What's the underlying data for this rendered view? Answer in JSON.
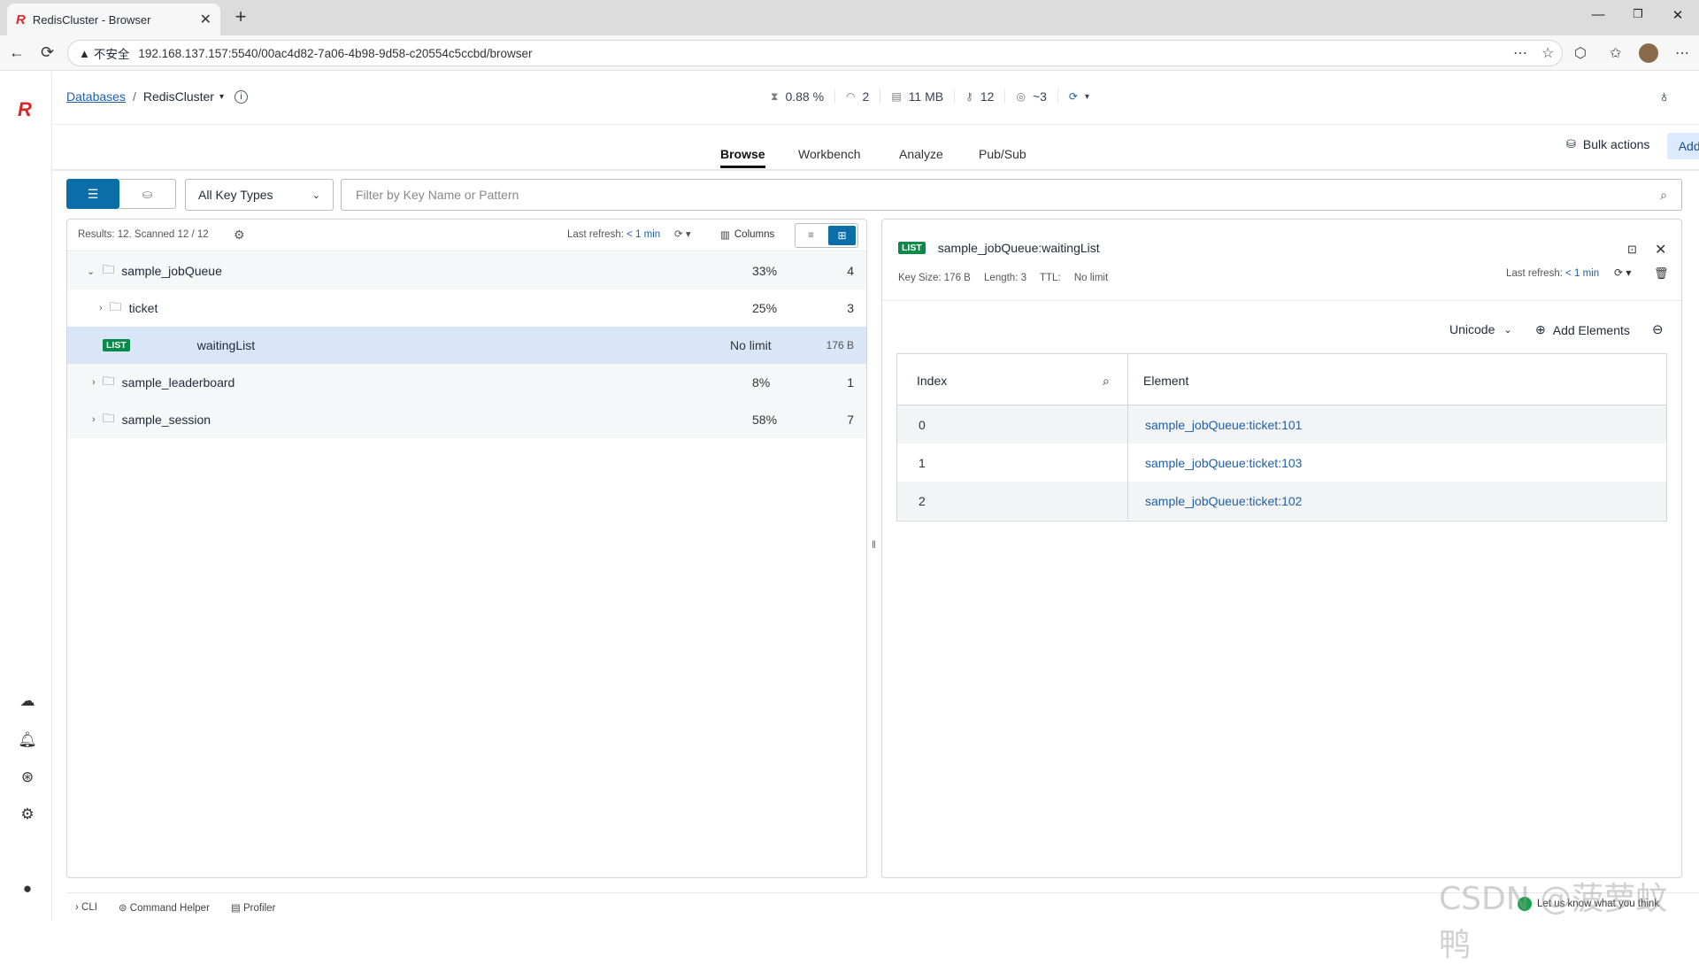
{
  "browser": {
    "tab_title": "RedisCluster - Browser",
    "security_warning": "不安全",
    "url": "192.168.137.157:5540/00ac4d82-7a06-4b98-9d58-c20554c5ccbd/browser"
  },
  "header": {
    "breadcrumb_root": "Databases",
    "breadcrumb_sep": "/",
    "database_name": "RedisCluster",
    "stats": [
      {
        "icon": "cpu-icon",
        "value": "0.88 %"
      },
      {
        "icon": "ops-icon",
        "value": "2"
      },
      {
        "icon": "memory-icon",
        "value": "11 MB"
      },
      {
        "icon": "keys-icon",
        "value": "12"
      },
      {
        "icon": "clients-icon",
        "value": "~3"
      }
    ]
  },
  "main_tabs": [
    {
      "label": "Browse",
      "active": true
    },
    {
      "label": "Workbench",
      "active": false
    },
    {
      "label": "Analyze",
      "active": false
    },
    {
      "label": "Pub/Sub",
      "active": false
    }
  ],
  "actions": {
    "bulk_actions": "Bulk actions",
    "add_key": "Add key"
  },
  "filter": {
    "key_type": "All Key Types",
    "search_placeholder": "Filter by Key Name or Pattern"
  },
  "key_list": {
    "results": "Results: 12. Scanned 12 / 12",
    "last_refresh_label": "Last refresh:",
    "last_refresh_value": "< 1 min",
    "columns_label": "Columns",
    "rows": [
      {
        "name": "sample_jobQueue",
        "type": "folder",
        "expanded": true,
        "percent": "33%",
        "count": "4",
        "depth": 0
      },
      {
        "name": "ticket",
        "type": "folder",
        "expanded": false,
        "percent": "25%",
        "count": "3",
        "depth": 1
      },
      {
        "name": "waitingList",
        "type": "LIST",
        "ttl": "No limit",
        "size": "176 B",
        "selected": true
      },
      {
        "name": "sample_leaderboard",
        "type": "folder",
        "expanded": false,
        "percent": "8%",
        "count": "1",
        "depth": 0
      },
      {
        "name": "sample_session",
        "type": "folder",
        "expanded": false,
        "percent": "58%",
        "count": "7",
        "depth": 0
      }
    ]
  },
  "details": {
    "type_badge": "LIST",
    "key_name": "sample_jobQueue:waitingList",
    "key_size": "Key Size: 176 B",
    "length": "Length: 3",
    "ttl_label": "TTL:",
    "ttl_value": "No limit",
    "last_refresh_label": "Last refresh:",
    "last_refresh_value": "< 1 min",
    "format": "Unicode",
    "add_elements": "Add Elements",
    "table": {
      "col_index": "Index",
      "col_element": "Element",
      "rows": [
        {
          "index": "0",
          "element": "sample_jobQueue:ticket:101"
        },
        {
          "index": "1",
          "element": "sample_jobQueue:ticket:103"
        },
        {
          "index": "2",
          "element": "sample_jobQueue:ticket:102"
        }
      ]
    }
  },
  "bottom": {
    "cli": "CLI",
    "command_helper": "Command Helper",
    "profiler": "Profiler",
    "feedback": "Let us know what you think"
  },
  "watermark": "CSDN @菠萝蚊鸭",
  "colors": {
    "accent": "#0b6ea8",
    "brand": "#dc2626",
    "list_badge": "#0a8a4a",
    "selected_row": "#d8e6f8"
  }
}
